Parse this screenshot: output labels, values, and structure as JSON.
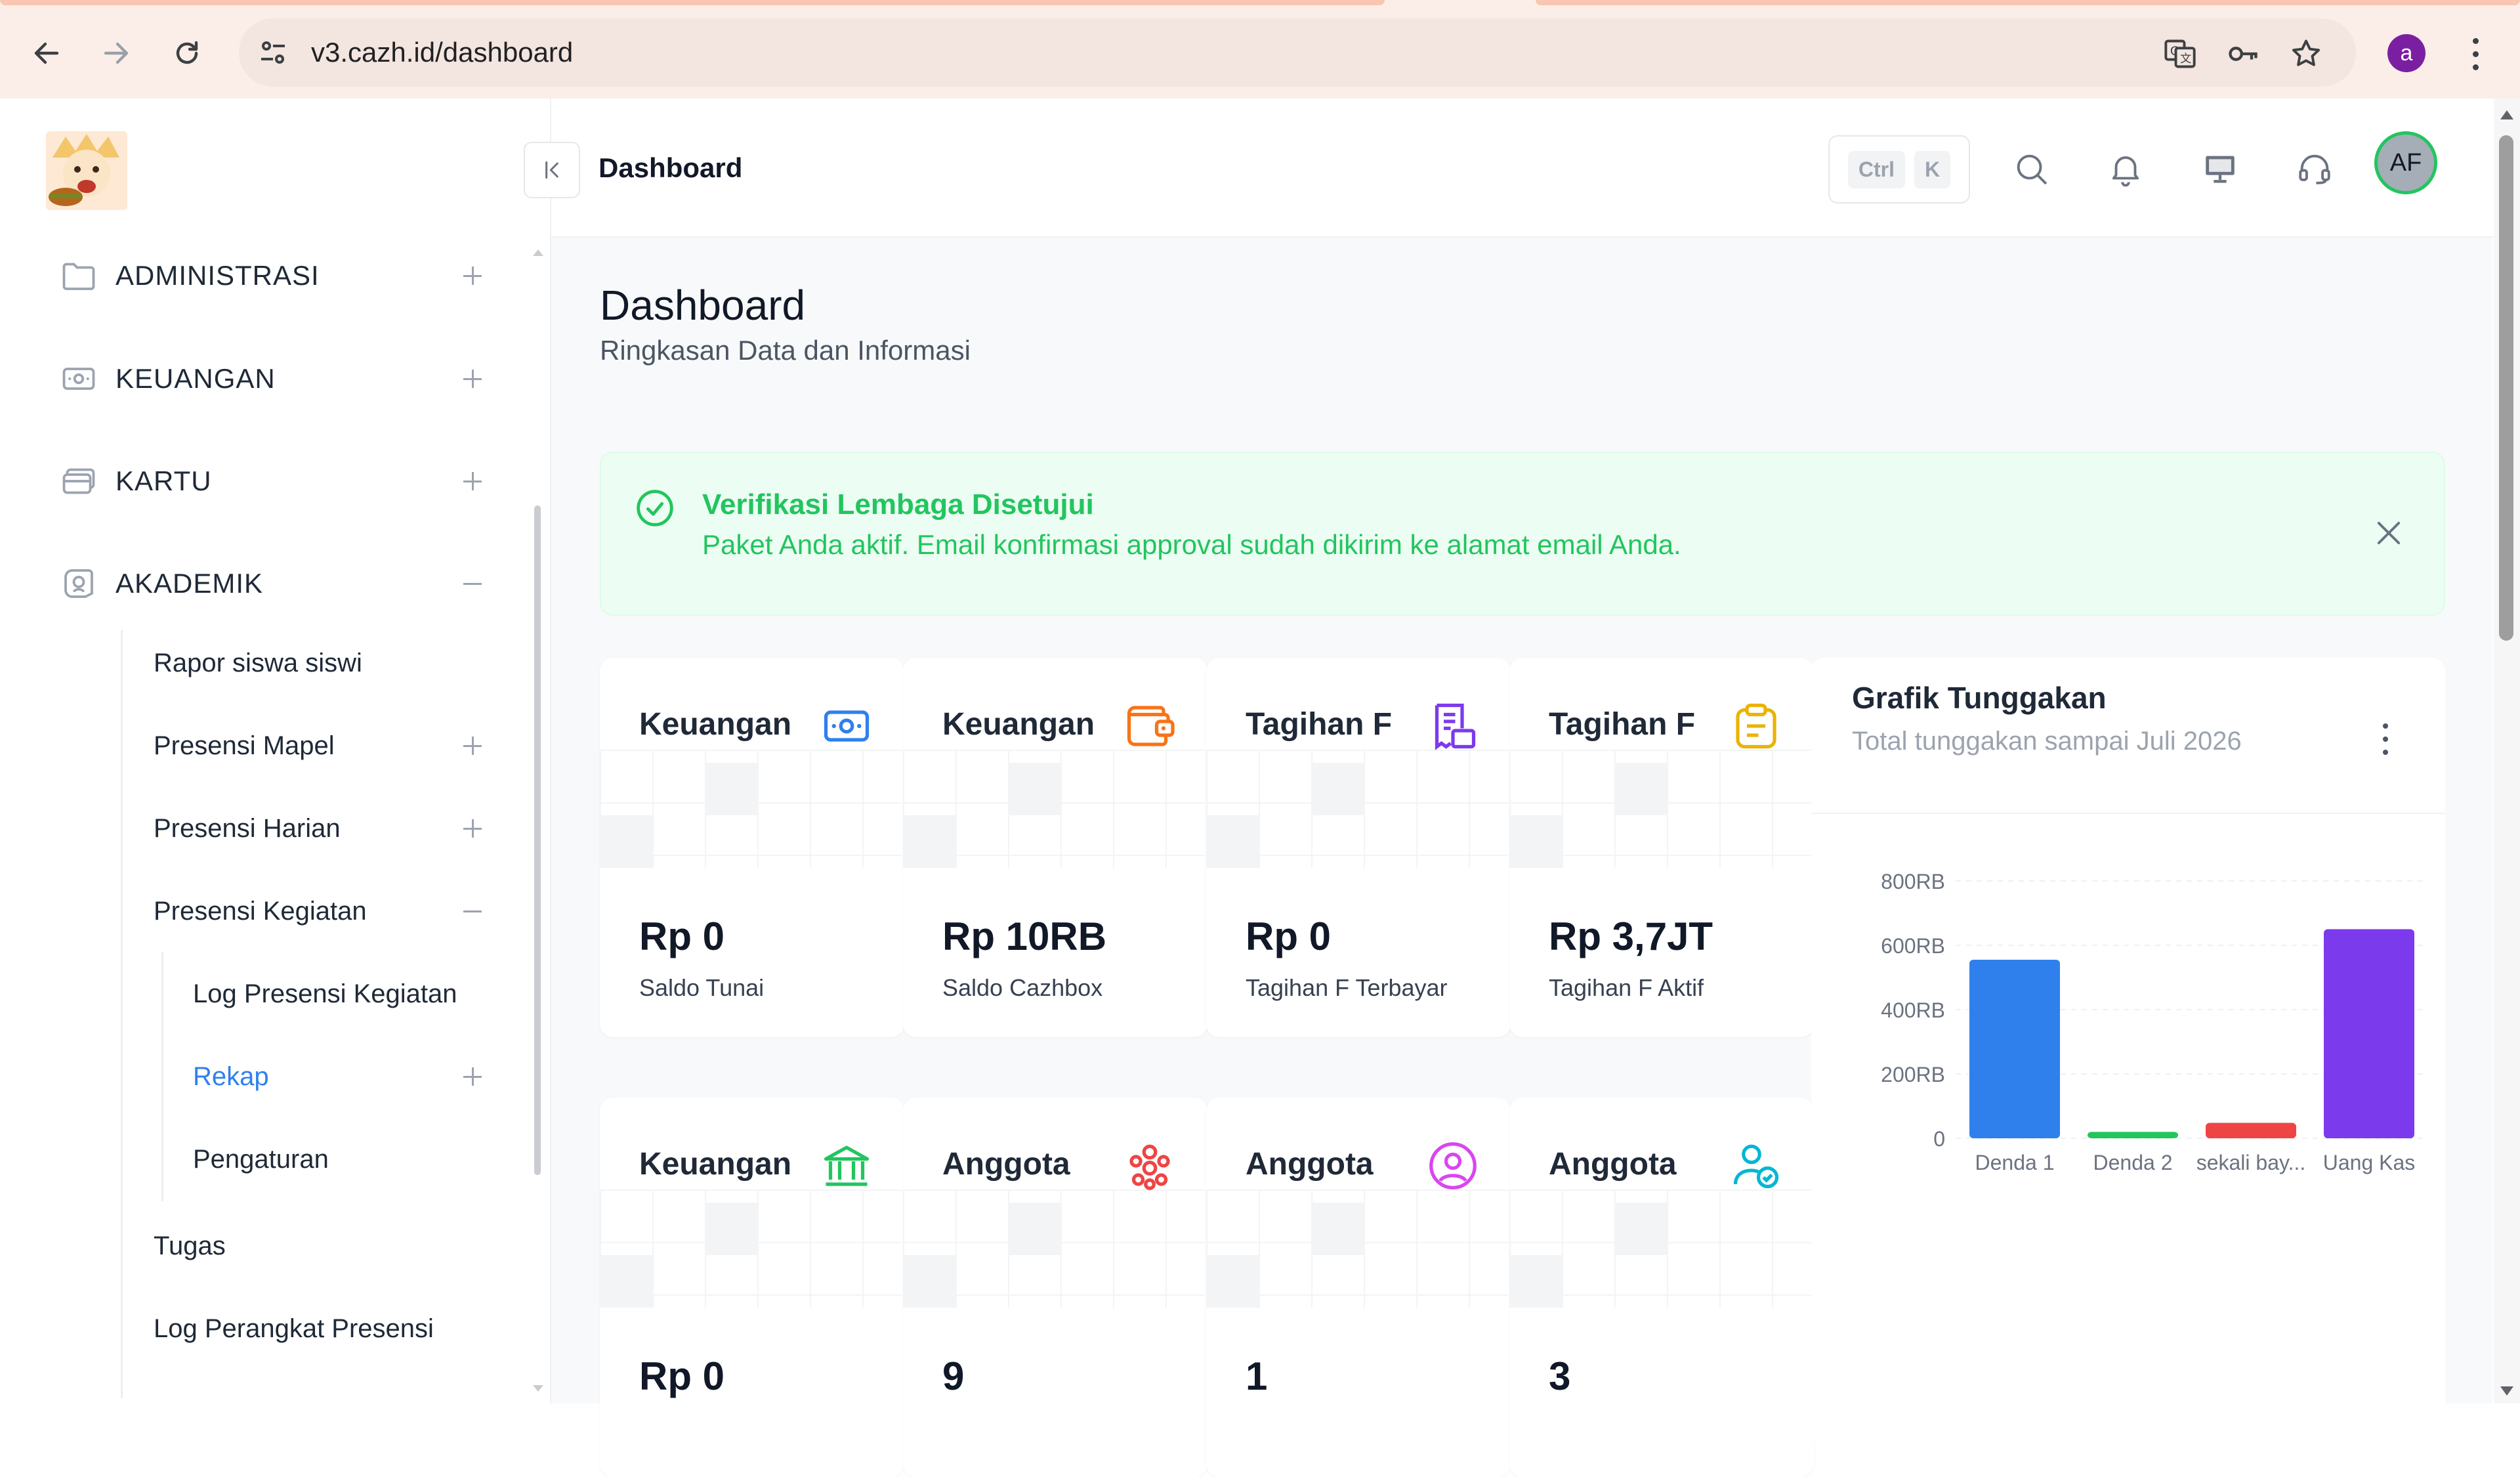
{
  "browser": {
    "url": "v3.cazh.id/dashboard",
    "profile_initial": "a"
  },
  "sidebar": {
    "sections": [
      {
        "label": "ADMINISTRASI",
        "icon": "folder-icon",
        "state": "collapsed"
      },
      {
        "label": "KEUANGAN",
        "icon": "money-icon",
        "state": "collapsed"
      },
      {
        "label": "KARTU",
        "icon": "card-icon",
        "state": "collapsed"
      },
      {
        "label": "AKADEMIK",
        "icon": "academic-icon",
        "state": "expanded"
      }
    ],
    "akademik_items": [
      {
        "label": "Rapor siswa siswi"
      },
      {
        "label": "Presensi Mapel"
      },
      {
        "label": "Presensi Harian"
      },
      {
        "label": "Presensi Kegiatan"
      },
      {
        "label": "Tugas"
      },
      {
        "label": "Log Perangkat Presensi"
      }
    ],
    "kegiatan_items": [
      {
        "label": "Log Presensi Kegiatan"
      },
      {
        "label": "Rekap"
      },
      {
        "label": "Pengaturan"
      }
    ],
    "active_color": "#2f80ed"
  },
  "header": {
    "title": "Dashboard",
    "shortcut_ctrl": "Ctrl",
    "shortcut_k": "K",
    "avatar_initials": "AF"
  },
  "page": {
    "title": "Dashboard",
    "subtitle": "Ringkasan Data dan Informasi"
  },
  "alert": {
    "title": "Verifikasi Lembaga Disetujui",
    "message": "Paket Anda aktif. Email konfirmasi approval sudah dikirim ke alamat email Anda.",
    "color": "#22c55e"
  },
  "cards": [
    {
      "title": "Keuangan",
      "value": "Rp 0",
      "label": "Saldo Tunai",
      "icon": "cash-icon",
      "color": "#2f80ed"
    },
    {
      "title": "Keuangan",
      "value": "Rp 10RB",
      "label": "Saldo Cazhbox",
      "icon": "wallet-icon",
      "color": "#f97316"
    },
    {
      "title": "Tagihan F",
      "value": "Rp 0",
      "label": "Tagihan F Terbayar",
      "icon": "invoice-icon",
      "color": "#7c3aed"
    },
    {
      "title": "Tagihan F",
      "value": "Rp 3,7JT",
      "label": "Tagihan F Aktif",
      "icon": "clipboard-icon",
      "color": "#eab308"
    },
    {
      "title": "Keuangan",
      "value": "Rp 0",
      "label": "",
      "icon": "bank-icon",
      "color": "#22c55e"
    },
    {
      "title": "Anggota",
      "value": "9",
      "label": "",
      "icon": "group-icon",
      "color": "#ef4444"
    },
    {
      "title": "Anggota",
      "value": "1",
      "label": "",
      "icon": "user-circle-icon",
      "color": "#d946ef"
    },
    {
      "title": "Anggota",
      "value": "3",
      "label": "",
      "icon": "user-check-icon",
      "color": "#06b6d4"
    }
  ],
  "chart": {
    "title": "Grafik Tunggakan",
    "subtitle": "Total tunggakan sampai Juli 2026"
  },
  "chart_data": {
    "type": "bar",
    "title": "Grafik Tunggakan",
    "subtitle": "Total tunggakan sampai Juli 2026",
    "categories": [
      "Denda 1",
      "Denda 2",
      "sekali bay...",
      "Uang Kas"
    ],
    "values": [
      555000,
      20000,
      48000,
      650000
    ],
    "colors": [
      "#2f80ed",
      "#22c55e",
      "#ef4444",
      "#7c3aed"
    ],
    "ylim": [
      0,
      800000
    ],
    "yticks": [
      0,
      200000,
      400000,
      600000,
      800000
    ],
    "ytick_labels": [
      "0",
      "200RB",
      "400RB",
      "600RB",
      "800RB"
    ],
    "grid": true,
    "legend": "none"
  }
}
